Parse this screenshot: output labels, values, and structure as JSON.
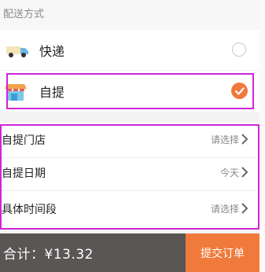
{
  "delivery": {
    "section_title": "配送方式",
    "options": [
      {
        "label": "快递",
        "selected": false,
        "icon": "truck-icon"
      },
      {
        "label": "自提",
        "selected": true,
        "icon": "store-icon"
      }
    ]
  },
  "pickup": {
    "rows": [
      {
        "label": "自提门店",
        "value": "请选择"
      },
      {
        "label": "自提日期",
        "value": "今天"
      },
      {
        "label": "具体时间段",
        "value": "请选择"
      }
    ]
  },
  "footer": {
    "total_label": "合计：¥13.32",
    "submit_label": "提交订单"
  },
  "colors": {
    "accent": "#f07a3c",
    "highlight": "#d024d8",
    "footer_bg": "#5a5655"
  }
}
